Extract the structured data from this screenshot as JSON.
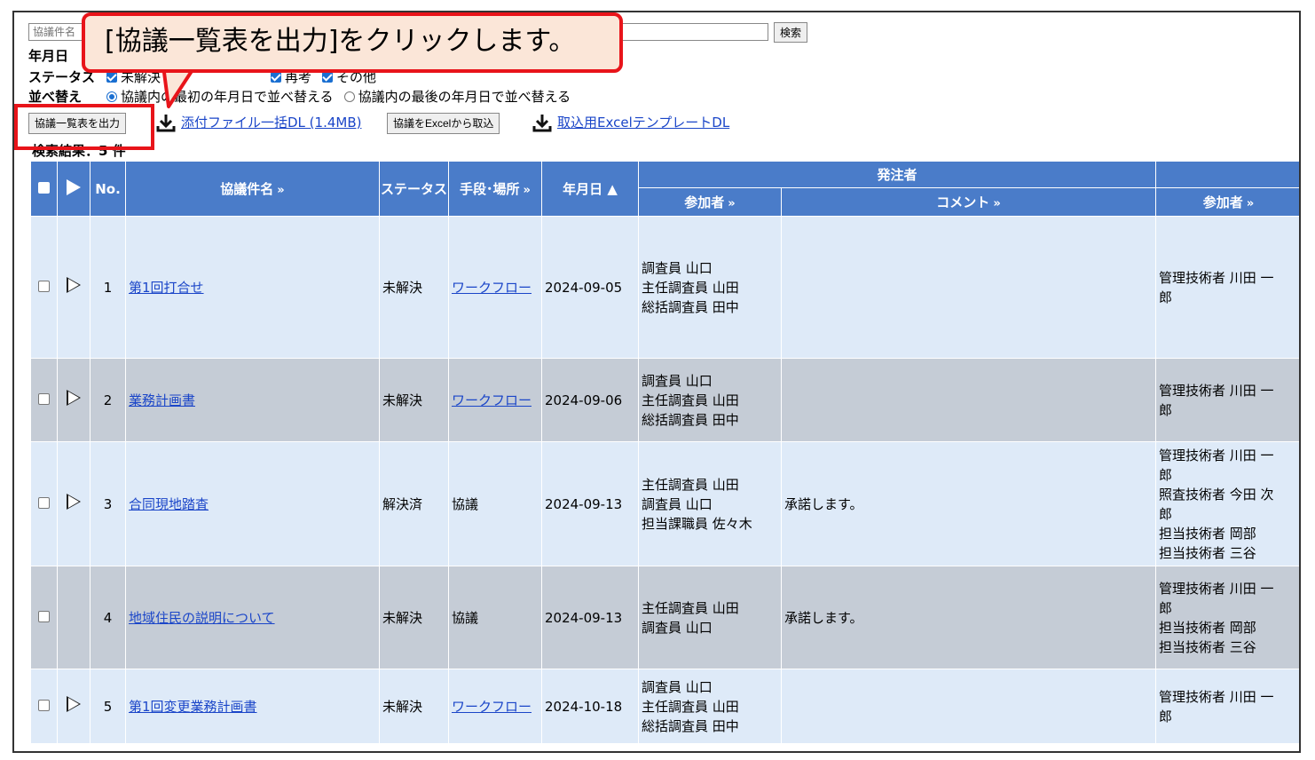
{
  "search": {
    "placeholder": "協議件名",
    "button": "検索"
  },
  "filters": {
    "date_label": "年月日",
    "status_label": "ステータス",
    "status_options": [
      "未解決",
      "再考",
      "その他"
    ],
    "sort_label": "並べ替え",
    "sort_option_selected": "協議内の最初の年月日で並べ替える",
    "sort_option_other": "協議内の最後の年月日で並べ替える"
  },
  "toolbar": {
    "export_list": "協議一覧表を出力",
    "attachments_dl": "添付ファイル一括DL (1.4MB)",
    "import_excel": "協議をExcelから取込",
    "template_dl": "取込用ExcelテンプレートDL"
  },
  "result_count": "検索結果：5 件",
  "callout": {
    "text": "[協議一覧表を出力]をクリックします。"
  },
  "table": {
    "headers": {
      "no": "No.",
      "title": "協議件名",
      "status": "ステータス",
      "method": "手段･場所",
      "date": "年月日 ▲",
      "orderer": "発注者",
      "participants": "参加者",
      "comment": "コメント",
      "participants2": "参加者",
      "chevron": "»"
    },
    "rows": [
      {
        "no": "1",
        "title": "第1回打合せ",
        "status": "未解決",
        "method": "ワークフロー",
        "method_link": true,
        "date": "2024-09-05",
        "participants": [
          "調査員 山口",
          "主任調査員 山田",
          "総括調査員 田中"
        ],
        "comment": "",
        "participants2": [
          "管理技術者 川田 一",
          "郎"
        ],
        "has_arrow": true
      },
      {
        "no": "2",
        "title": "業務計画書",
        "status": "未解決",
        "method": "ワークフロー",
        "method_link": true,
        "date": "2024-09-06",
        "participants": [
          "調査員 山口",
          "主任調査員 山田",
          "総括調査員 田中"
        ],
        "comment": "",
        "participants2": [
          "管理技術者 川田 一",
          "郎"
        ],
        "has_arrow": true
      },
      {
        "no": "3",
        "title": "合同現地踏査",
        "status": "解決済",
        "method": "協議",
        "method_link": false,
        "date": "2024-09-13",
        "participants": [
          "主任調査員 山田",
          "調査員 山口",
          "担当課職員 佐々木"
        ],
        "comment": "承諾します。",
        "participants2": [
          "管理技術者 川田 一",
          "郎",
          "照査技術者 今田 次",
          "郎",
          "担当技術者 岡部",
          "担当技術者 三谷"
        ],
        "has_arrow": true
      },
      {
        "no": "4",
        "title": "地域住民の説明について",
        "status": "未解決",
        "method": "協議",
        "method_link": false,
        "date": "2024-09-13",
        "participants": [
          "主任調査員 山田",
          "調査員 山口"
        ],
        "comment": "承諾します。",
        "participants2": [
          "管理技術者 川田 一",
          "郎",
          "担当技術者 岡部",
          "担当技術者 三谷"
        ],
        "has_arrow": false
      },
      {
        "no": "5",
        "title": "第1回変更業務計画書",
        "status": "未解決",
        "method": "ワークフロー",
        "method_link": true,
        "date": "2024-10-18",
        "participants": [
          "調査員 山口",
          "主任調査員 山田",
          "総括調査員 田中"
        ],
        "comment": "",
        "participants2": [
          "管理技術者 川田 一",
          "郎"
        ],
        "has_arrow": true
      }
    ]
  },
  "colors": {
    "header_blue": "#4a7cc9",
    "row_light": "#deeaf8",
    "row_gray": "#c5ccd6",
    "highlight_red": "#e8141a",
    "callout_bg": "#fbe6d8",
    "link": "#1a45c8"
  }
}
